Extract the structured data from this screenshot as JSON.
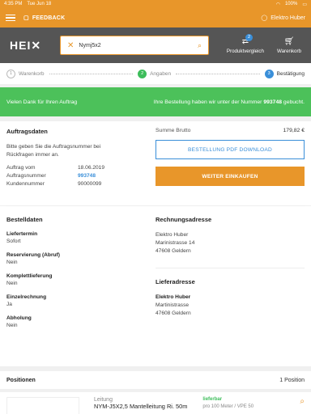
{
  "statusbar": {
    "time": "4:35 PM",
    "date": "Tue Jun 18",
    "battery": "100%"
  },
  "topbar": {
    "feedback_label": "FEEDBACK",
    "user_name": "Elektro Huber"
  },
  "header": {
    "logo": "HEI",
    "search_value": "Nymj5x2",
    "compare_label": "Produktvergleich",
    "compare_count": "2",
    "cart_label": "Warenkorb"
  },
  "steps": [
    {
      "num": "1",
      "label": "Warenkorb"
    },
    {
      "num": "2",
      "label": "Angaben"
    },
    {
      "num": "3",
      "label": "Bestätigung"
    }
  ],
  "success": {
    "left": "Vielen Dank für Ihren Auftrag",
    "right_prefix": "Ihre Bestellung haben wir unter der Nummer",
    "order_number": "993748",
    "right_suffix": "gebucht."
  },
  "order": {
    "title": "Auftragsdaten",
    "instruction": "Bitte geben Sie die Auftragsnummer bei Rückfragen immer an.",
    "date_label": "Auftrag vom",
    "date_value": "18.06.2019",
    "number_label": "Auftragsnummer",
    "number_value": "993748",
    "customer_label": "Kundennummer",
    "customer_value": "90000099",
    "sum_label": "Summe Brutto",
    "sum_value": "179,82 €",
    "pdf_button": "BESTELLUNG PDF DOWNLOAD",
    "continue_button": "WEITER EINKAUFEN"
  },
  "details": {
    "title": "Bestelldaten",
    "fields": [
      {
        "label": "Liefertermin",
        "value": "Sofort"
      },
      {
        "label": "Reservierung (Abruf)",
        "value": "Nein"
      },
      {
        "label": "Komplettlieferung",
        "value": "Nein"
      },
      {
        "label": "Einzelrechnung",
        "value": "Ja"
      },
      {
        "label": "Abholung",
        "value": "Nein"
      }
    ],
    "billing_title": "Rechnungsadresse",
    "billing": {
      "name": "Elektro Huber",
      "street": "Marinistrasse 14",
      "city": "47608 Geldern"
    },
    "delivery_title": "Lieferadresse",
    "delivery": {
      "name": "Elektro Huber",
      "street": "Martinistrasse",
      "city": "47608 Geldern"
    }
  },
  "positions": {
    "title": "Positionen",
    "count": "1 Position"
  },
  "product": {
    "category": "Leitung",
    "name": "NYM-J5X2,5 Mantelleitung Ri. 50m",
    "stock": "lieferbar",
    "unit": "pro 100 Meter / VPE 50"
  },
  "colors": {
    "accent": "#e8962a",
    "header": "#555555",
    "success": "#4cc15a",
    "link": "#3a8fd9"
  }
}
